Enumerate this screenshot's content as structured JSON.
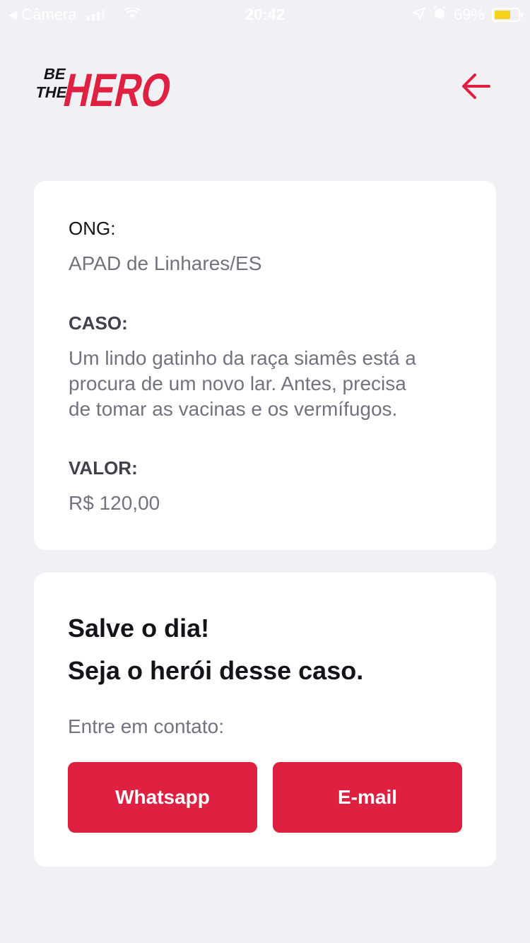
{
  "status_bar": {
    "back_app": "Câmera",
    "time": "20:42",
    "battery": "69%",
    "battery_level": 0.69
  },
  "header": {
    "logo_text": [
      "BE",
      "THE",
      "HERO"
    ],
    "back_icon": "arrow-left-icon",
    "accent_color": "#e02041"
  },
  "incident": {
    "ong_label": "ONG:",
    "ong_value": "APAD de Linhares/ES",
    "case_label": "CASO:",
    "case_lines": [
      "Um lindo gatinho da raça siamês está a",
      "procura de um novo lar. Antes, precisa",
      "de tomar as vacinas e os vermífugos."
    ],
    "value_label": "VALOR:",
    "value": "R$ 120,00"
  },
  "contact": {
    "title_line1": "Salve o dia!",
    "title_line2": "Seja o herói desse caso.",
    "description": "Entre em contato:",
    "whatsapp_label": "Whatsapp",
    "email_label": "E-mail"
  }
}
